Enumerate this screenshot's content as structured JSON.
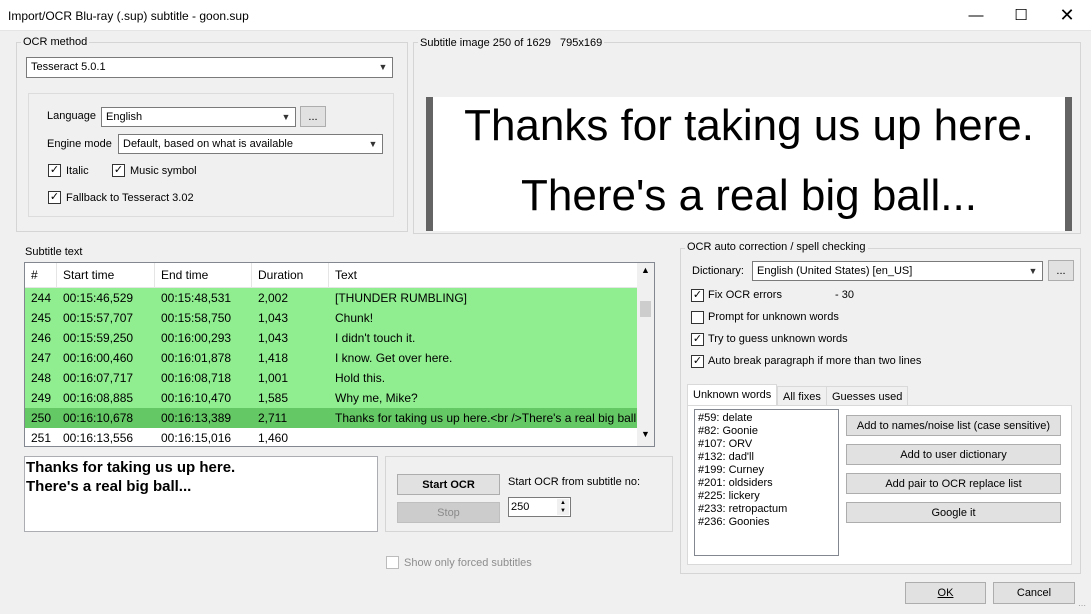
{
  "window": {
    "title": "Import/OCR Blu-ray (.sup) subtitle - goon.sup",
    "minimize_icon": "minimize-icon",
    "maximize_icon": "maximize-icon",
    "close_icon": "close-icon"
  },
  "ocr_method": {
    "legend": "OCR method",
    "engine": "Tesseract 5.0.1",
    "language_label": "Language",
    "language": "English",
    "language_more": "...",
    "engine_mode_label": "Engine mode",
    "engine_mode": "Default, based on what is available",
    "italic_label": "Italic",
    "italic_checked": true,
    "music_label": "Music symbol",
    "music_checked": true,
    "fallback_label": "Fallback to Tesseract 3.02",
    "fallback_checked": true
  },
  "subtitle_image": {
    "header": "Subtitle image 250 of 1629   795x169",
    "line1": "Thanks for taking us up here.",
    "line2": "There's a real big ball..."
  },
  "subtitle_text": {
    "legend": "Subtitle text",
    "columns": [
      "#",
      "Start time",
      "End time",
      "Duration",
      "Text"
    ],
    "rows": [
      {
        "num": "244",
        "start": "00:15:46,529",
        "end": "00:15:48,531",
        "dur": "2,002",
        "text": "[THUNDER RUMBLING]",
        "state": "ok"
      },
      {
        "num": "245",
        "start": "00:15:57,707",
        "end": "00:15:58,750",
        "dur": "1,043",
        "text": "Chunk!",
        "state": "ok"
      },
      {
        "num": "246",
        "start": "00:15:59,250",
        "end": "00:16:00,293",
        "dur": "1,043",
        "text": "I didn't touch it.",
        "state": "ok"
      },
      {
        "num": "247",
        "start": "00:16:00,460",
        "end": "00:16:01,878",
        "dur": "1,418",
        "text": "I know. Get over here.",
        "state": "ok"
      },
      {
        "num": "248",
        "start": "00:16:07,717",
        "end": "00:16:08,718",
        "dur": "1,001",
        "text": "Hold this.",
        "state": "ok"
      },
      {
        "num": "249",
        "start": "00:16:08,885",
        "end": "00:16:10,470",
        "dur": "1,585",
        "text": "Why me, Mike?",
        "state": "ok"
      },
      {
        "num": "250",
        "start": "00:16:10,678",
        "end": "00:16:13,389",
        "dur": "2,711",
        "text": "Thanks for taking us up here.<br />There's a real big ball...",
        "state": "selected"
      },
      {
        "num": "251",
        "start": "00:16:13,556",
        "end": "00:16:15,016",
        "dur": "1,460",
        "text": "",
        "state": "none"
      }
    ],
    "scroll_up_icon": "scroll-up-icon",
    "scroll_down_icon": "scroll-down-icon"
  },
  "ocr_text": {
    "line1": "Thanks for taking us up here.",
    "line2": "There's a real big ball..."
  },
  "controls": {
    "start_ocr": "Start OCR",
    "stop": "Stop",
    "start_from_label": "Start OCR from subtitle no:",
    "start_from_value": "250",
    "forced_label": "Show only forced subtitles",
    "forced_checked": false
  },
  "autocorrect": {
    "legend": "OCR auto correction / spell checking",
    "dictionary_label": "Dictionary:",
    "dictionary": "English (United States) [en_US]",
    "dictionary_more": "...",
    "fix_ocr_label": "Fix OCR errors",
    "fix_ocr_count": "- 30",
    "fix_ocr_checked": true,
    "prompt_label": "Prompt for unknown words",
    "prompt_checked": false,
    "guess_label": "Try to guess unknown words",
    "guess_checked": true,
    "autobreak_label": "Auto break paragraph if more than two lines",
    "autobreak_checked": true,
    "tabs": [
      "Unknown words",
      "All fixes",
      "Guesses used"
    ],
    "active_tab": 0,
    "unknown_words": [
      "#59: delate",
      "#82: Goonie",
      "#107: ORV",
      "#132: dad'll",
      "#199: Curney",
      "#201: oldsiders",
      "#225: lickery",
      "#233: retropactum",
      "#236: Goonies"
    ],
    "add_names": "Add to names/noise list (case sensitive)",
    "add_user_dict": "Add to user dictionary",
    "add_pair": "Add pair to OCR replace list",
    "google": "Google it"
  },
  "footer": {
    "ok": "OK",
    "cancel": "Cancel",
    "resize_grip_icon": "resize-grip-icon"
  },
  "colors": {
    "ok_row": "#90ee90",
    "selected_row": "#64c864",
    "image_bar": "#646464"
  }
}
